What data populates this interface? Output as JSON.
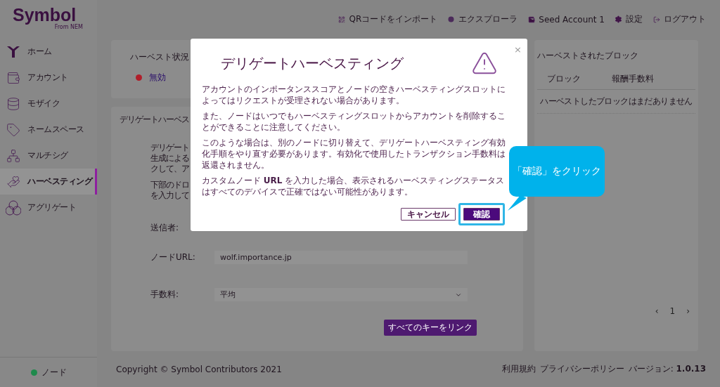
{
  "logo": {
    "name": "Symbol",
    "tagline": "From NEM"
  },
  "header_nav": [
    {
      "kind": "qr",
      "label": "QRコードをインポート"
    },
    {
      "kind": "explorer",
      "label": "エクスプローラ"
    },
    {
      "kind": "wallet",
      "label": "Seed Account 1"
    },
    {
      "kind": "settings",
      "label": "設定"
    },
    {
      "kind": "logout",
      "label": "ログアウト"
    }
  ],
  "sidebar": {
    "items": [
      {
        "kind": "home",
        "label": "ホーム",
        "selected": false
      },
      {
        "kind": "account",
        "label": "アカウント",
        "selected": false
      },
      {
        "kind": "mosaic",
        "label": "モザイク",
        "selected": false
      },
      {
        "kind": "namespace",
        "label": "ネームスペース",
        "selected": false
      },
      {
        "kind": "multisig",
        "label": "マルチシグ",
        "selected": false
      },
      {
        "kind": "harvesting",
        "label": "ハーベスティング",
        "selected": true
      },
      {
        "kind": "aggregate",
        "label": "アグリゲート",
        "selected": false
      }
    ],
    "node_status": {
      "label": "ノード",
      "connected": true
    }
  },
  "harvest_status": {
    "title": "ハーベスト状況",
    "status": "無効",
    "active": false
  },
  "delegated_card": {
    "title": "デリゲートハーベス",
    "paragraphs": [
      [
        "デリゲート",
        "生成による",
        "クして、ア"
      ],
      [
        "下部のドロ",
        "を入力して"
      ]
    ],
    "fields": [
      {
        "label": "送信者:"
      },
      {
        "label": "ノードURL:",
        "value": "wolf.importance.jp"
      },
      {
        "label": "手数料:",
        "value": "平均",
        "kind": "select"
      }
    ],
    "button": "すべてのキーをリンク"
  },
  "harvested_blocks": {
    "title": "ハーベストされたブロック",
    "columns": [
      "ブロック",
      "報酬手数料"
    ],
    "empty": "ハーベストしたブロックはまだありません",
    "pagination": {
      "prev": "‹",
      "page": "1",
      "next": "›"
    }
  },
  "footer": {
    "copyright": "Copyright © Symbol Contributors 2021",
    "links": [
      "利用規約",
      "プライバシーポリシー"
    ],
    "version": "バージョン: **1.0.13**"
  },
  "modal": {
    "title": "デリゲートハーベスティング",
    "close": "×",
    "paragraphs": [
      "アカウントのインポータンススコアとノードの空きハーベスティングスロットによってはリクエストが受理されない場合があります。",
      "また、ノードはいつでもハーベスティングスロットからアカウントを削除することができることに注意してください。",
      "このような場合は、別のノードに切り替えて、デリゲートハーベスティング有効化手順をやり直す必要があります。有効化で使用したトランザクション手数料は返還されません。",
      "カスタムノード **URL** を入力した場合、表示されるハーベスティングステータスはすべてのデバイスで正確ではない可能性があります。"
    ],
    "buttons": [
      {
        "kind": "secondary",
        "label": "キャンセル"
      },
      {
        "kind": "primary",
        "label": "確認",
        "highlighted": true
      }
    ]
  },
  "callout": {
    "text": "「確認」をクリック"
  }
}
